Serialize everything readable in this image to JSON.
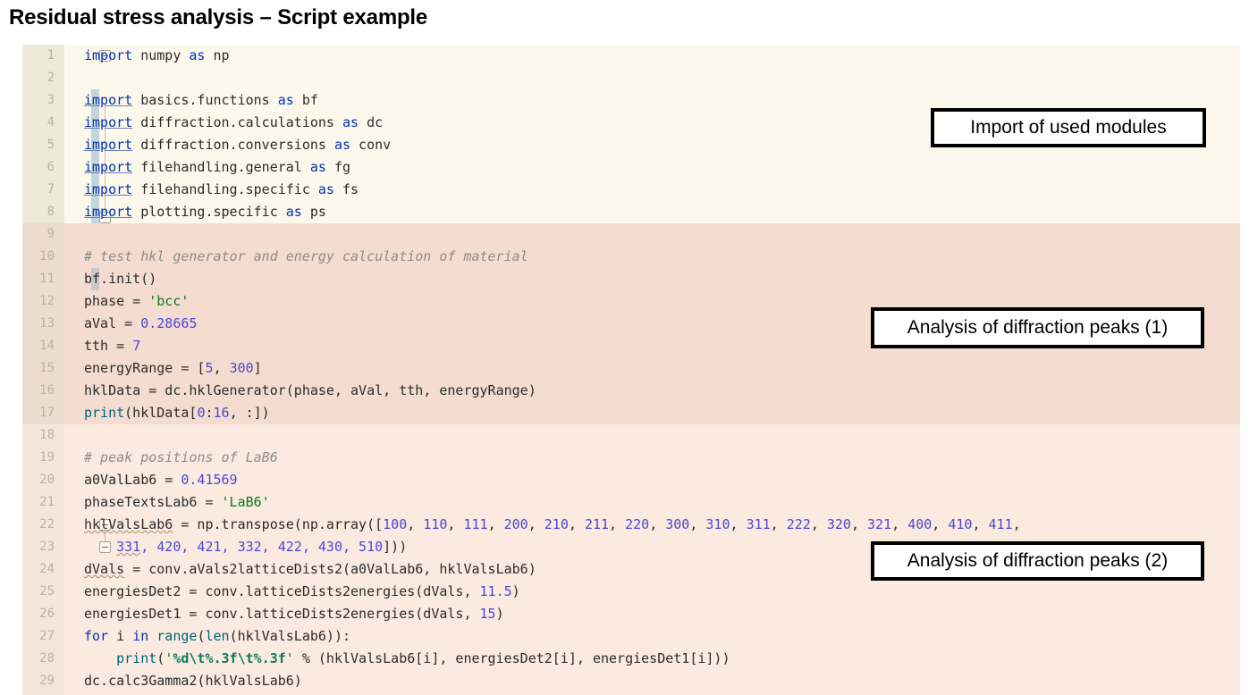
{
  "slide": {
    "title": "Residual stress analysis – Script example"
  },
  "colors": {
    "block1_bg": "#fdf8ec",
    "block2_bg": "#f4ddd0",
    "block3_bg": "#fbeae0",
    "gutter_tint": "#efe9d9",
    "gutter_tint2": "#eddcd0",
    "gutter_tint3": "#f5e6dc",
    "keyword": "#0033b3",
    "number": "#4a47d4",
    "string": "#067d17",
    "comment": "#8c8c8c",
    "function": "#00627a",
    "change_bar_blue": "#c3d6dd",
    "change_bar_gray": "#c8c8c8",
    "callout_border": "#000000"
  },
  "callouts": [
    {
      "id": "callout-1",
      "label": "Import of used modules"
    },
    {
      "id": "callout-2",
      "label": "Analysis of diffraction peaks (1)"
    },
    {
      "id": "callout-3",
      "label": "Analysis of diffraction peaks (2)"
    }
  ],
  "editor": {
    "blocks": [
      {
        "name": "imports-block",
        "bg": "#fdf8ec",
        "gutter_bg": "#efe9d9",
        "lines": [
          {
            "n": "1",
            "text": "import numpy as np"
          },
          {
            "n": "2",
            "text": ""
          },
          {
            "n": "3",
            "text": "import basics.functions as bf"
          },
          {
            "n": "4",
            "text": "import diffraction.calculations as dc"
          },
          {
            "n": "5",
            "text": "import diffraction.conversions as conv"
          },
          {
            "n": "6",
            "text": "import filehandling.general as fg"
          },
          {
            "n": "7",
            "text": "import filehandling.specific as fs"
          },
          {
            "n": "8",
            "text": "import plotting.specific as ps"
          }
        ]
      },
      {
        "name": "analysis-1-block",
        "bg": "#f4ddd0",
        "gutter_bg": "#eddcd0",
        "lines": [
          {
            "n": "9",
            "text": ""
          },
          {
            "n": "10",
            "text": "# test hkl generator and energy calculation of material"
          },
          {
            "n": "11",
            "text": "bf.init()"
          },
          {
            "n": "12",
            "text": "phase = 'bcc'"
          },
          {
            "n": "13",
            "text": "aVal = 0.28665"
          },
          {
            "n": "14",
            "text": "tth = 7"
          },
          {
            "n": "15",
            "text": "energyRange = [5, 300]"
          },
          {
            "n": "16",
            "text": "hklData = dc.hklGenerator(phase, aVal, tth, energyRange)"
          },
          {
            "n": "17",
            "text": "print(hklData[0:16, :])"
          }
        ]
      },
      {
        "name": "analysis-2-block",
        "bg": "#fbeae0",
        "gutter_bg": "#f5e6dc",
        "lines": [
          {
            "n": "18",
            "text": ""
          },
          {
            "n": "19",
            "text": "# peak positions of LaB6"
          },
          {
            "n": "20",
            "text": "a0ValLab6 = 0.41569"
          },
          {
            "n": "21",
            "text": "phaseTextsLab6 = 'LaB6'"
          },
          {
            "n": "22",
            "text": "hklValsLab6 = np.transpose(np.array([100, 110, 111, 200, 210, 211, 220, 300, 310, 311, 222, 320, 321, 400, 410, 411,"
          },
          {
            "n": "23",
            "text": "    331, 420, 421, 332, 422, 430, 510]))"
          },
          {
            "n": "24",
            "text": "dVals = conv.aVals2latticeDists2(a0ValLab6, hklValsLab6)"
          },
          {
            "n": "25",
            "text": "energiesDet2 = conv.latticeDists2energies(dVals, 11.5)"
          },
          {
            "n": "26",
            "text": "energiesDet1 = conv.latticeDists2energies(dVals, 15)"
          },
          {
            "n": "27",
            "text": "for i in range(len(hklValsLab6)):"
          },
          {
            "n": "28",
            "text": "    print('%d\\t%.3f\\t%.3f' % (hklValsLab6[i], energiesDet2[i], energiesDet1[i]))"
          },
          {
            "n": "29",
            "text": "dc.calc3Gamma2(hklValsLab6)"
          }
        ]
      }
    ]
  }
}
